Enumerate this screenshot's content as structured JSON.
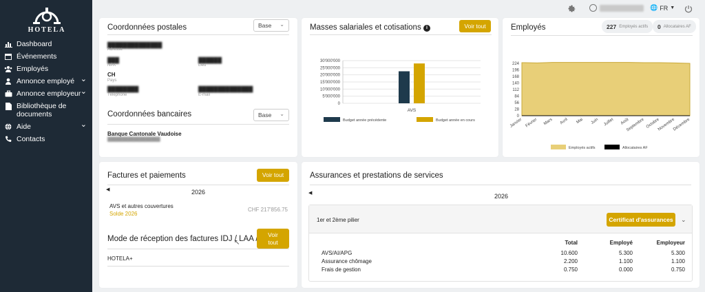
{
  "brand": {
    "name": "HOTELA"
  },
  "sidebar": {
    "items": [
      {
        "label": "Dashboard",
        "icon": "chart-bar-icon",
        "expandable": false
      },
      {
        "label": "Événements",
        "icon": "calendar-icon",
        "expandable": false
      },
      {
        "label": "Employés",
        "icon": "users-icon",
        "expandable": false
      },
      {
        "label": "Annonce employé",
        "icon": "user-icon",
        "expandable": true
      },
      {
        "label": "Annonce employeur",
        "icon": "briefcase-icon",
        "expandable": true
      },
      {
        "label": "Bibliothèque de documents",
        "icon": "file-icon",
        "expandable": false
      },
      {
        "label": "Aide",
        "icon": "globe-icon",
        "expandable": true
      },
      {
        "label": "Contacts",
        "icon": "phone-icon",
        "expandable": false
      }
    ]
  },
  "topbar": {
    "user_name": "██████████",
    "lang": "FR"
  },
  "postal": {
    "title": "Coordonnées postales",
    "select": "Base",
    "address_value": "██████████████",
    "address_label": "Adresse",
    "npa_value": "███",
    "npa_label": "NPA",
    "lieu_value": "██████",
    "lieu_label": "Lieu",
    "pays_value": "CH",
    "pays_label": "Pays",
    "tel_value": "████████",
    "tel_label": "Téléphone",
    "email_value": "██████████████",
    "email_label": "E-mail"
  },
  "bank": {
    "title": "Coordonnées bancaires",
    "select": "Base",
    "bank_name": "Banque Cantonale Vaudoise",
    "iban": "██████████████████"
  },
  "salary": {
    "title": "Masses salariales et cotisations",
    "button": "Voir tout"
  },
  "employees": {
    "title": "Employés",
    "active_count": "227",
    "active_label": "Employés actifs",
    "af_count": "0",
    "af_label": "Allocataires AF"
  },
  "invoices": {
    "title": "Factures et paiements",
    "button": "Voir tout",
    "year": "2026",
    "item_label": "AVS et autres couvertures",
    "item_sub": "Solde 2026",
    "item_amount": "CHF 217'856.75",
    "mode_title": "Mode de réception des factures IDJ / LAA / LAAC",
    "mode_button": "Voir tout",
    "mode_value": "HOTELA+"
  },
  "insurance": {
    "title": "Assurances et prestations de services",
    "year": "2026",
    "section_title": "1er et 2ème pilier",
    "cert_button": "Certificat d'assurances",
    "headers": [
      "Total",
      "Employé",
      "Employeur"
    ],
    "rows": [
      {
        "label": "AVS/AI/APG",
        "values": [
          "10.600",
          "5.300",
          "5.300"
        ]
      },
      {
        "label": "Assurance chômage",
        "values": [
          "2.200",
          "1.100",
          "1.100"
        ]
      },
      {
        "label": "Frais de gestion",
        "values": [
          "0.750",
          "0.000",
          "0.750"
        ]
      }
    ]
  },
  "colors": {
    "gold": "#d4a500",
    "navy": "#1e3a4c",
    "area": "#e8cf78",
    "sidebar": "#1e2a36"
  },
  "chart_data": [
    {
      "type": "bar",
      "categories": [
        "AVS"
      ],
      "series": [
        {
          "name": "Budget année précédente",
          "values": [
            22500000
          ],
          "color": "#1e3a4c"
        },
        {
          "name": "Budget année en cours",
          "values": [
            28000000
          ],
          "color": "#d4a500"
        }
      ],
      "yticks": [
        "30'000'000",
        "25'000'000",
        "20'000'000",
        "15'000'000",
        "10'000'000",
        "5'000'000",
        "0"
      ],
      "ylim": [
        0,
        30000000
      ],
      "grid": true,
      "legend": "bottom"
    },
    {
      "type": "area",
      "categories": [
        "Janvier",
        "Février",
        "Mars",
        "Avril",
        "Mai",
        "Juin",
        "Juillet",
        "Août",
        "Septembre",
        "Octobre",
        "Novembre",
        "Décembre"
      ],
      "series": [
        {
          "name": "Employés actifs",
          "values": [
            227,
            226,
            228,
            228,
            228,
            228,
            228,
            228,
            227,
            227,
            226,
            224
          ],
          "color": "#e8cf78"
        },
        {
          "name": "Allocataires AF",
          "values": [
            0,
            0,
            0,
            0,
            0,
            0,
            0,
            0,
            0,
            0,
            0,
            0
          ],
          "color": "#000000"
        }
      ],
      "yticks": [
        "224",
        "196",
        "168",
        "140",
        "112",
        "84",
        "56",
        "28",
        "0"
      ],
      "ylim": [
        0,
        224
      ],
      "grid": true,
      "legend": "bottom"
    }
  ]
}
